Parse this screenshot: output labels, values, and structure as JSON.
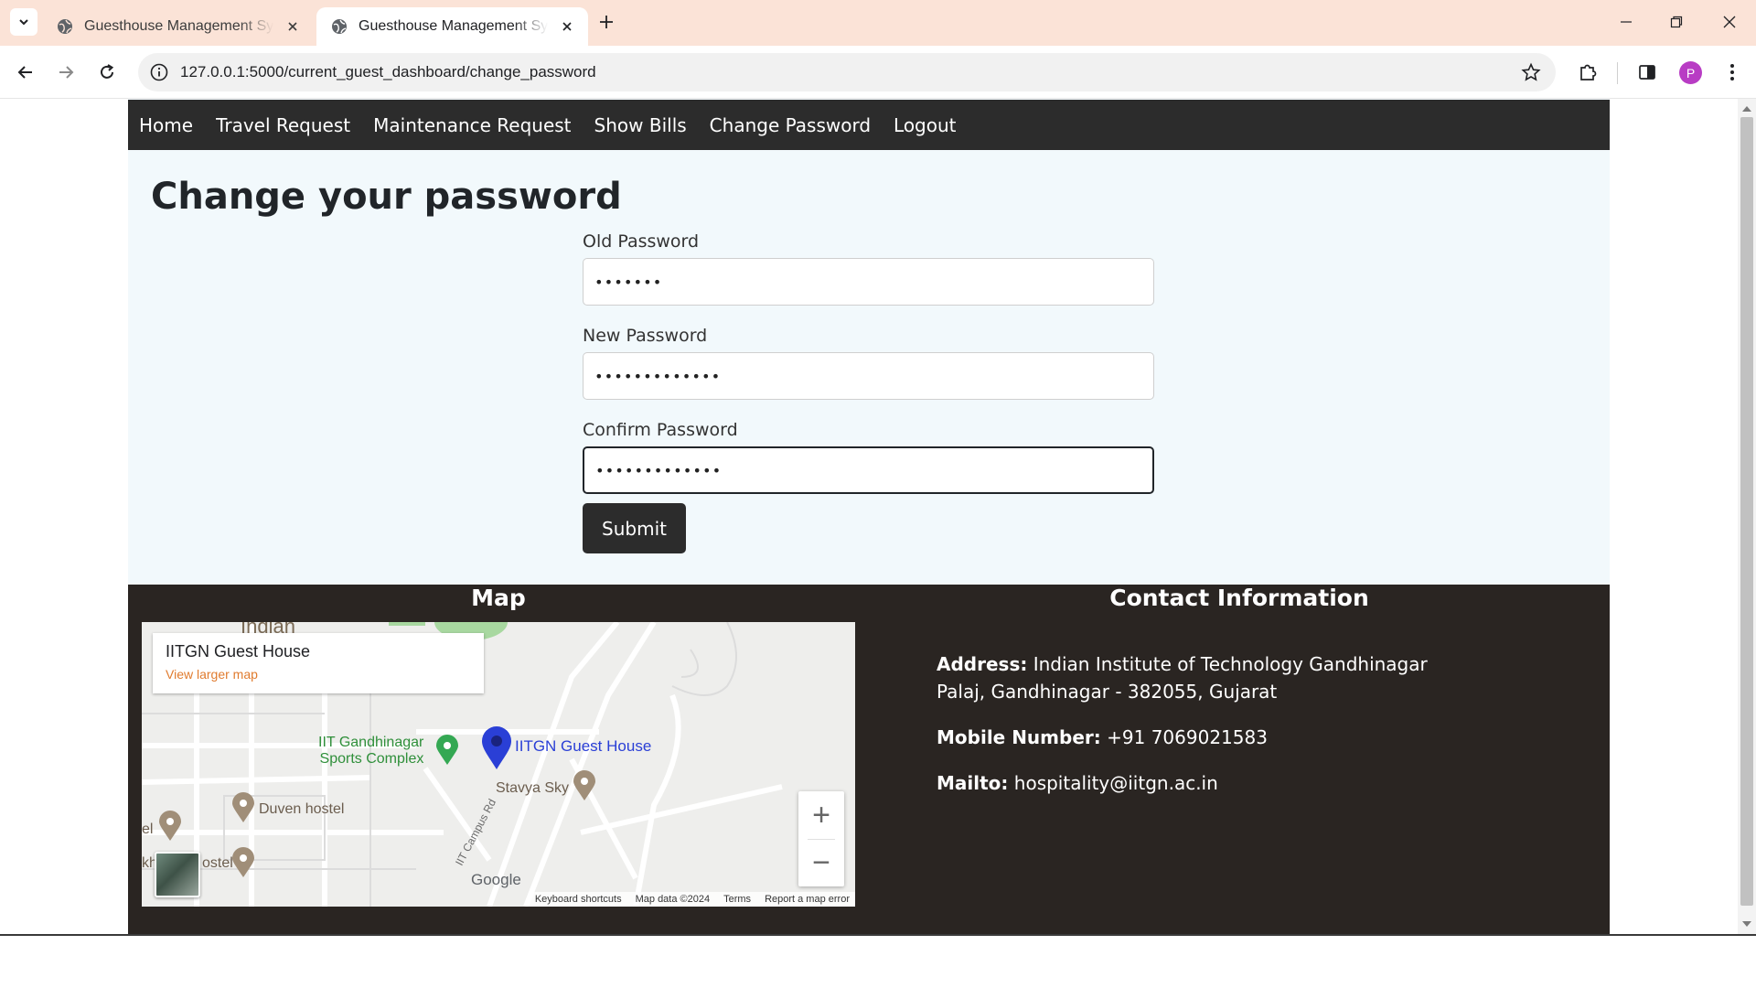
{
  "browser": {
    "tabs": [
      {
        "title": "Guesthouse Management System",
        "active": false
      },
      {
        "title": "Guesthouse Management System",
        "active": true
      }
    ],
    "url": "127.0.0.1:5000/current_guest_dashboard/change_password",
    "profile_initial": "P"
  },
  "nav": {
    "items": [
      "Home",
      "Travel Request",
      "Maintenance Request",
      "Show Bills",
      "Change Password",
      "Logout"
    ]
  },
  "page": {
    "title": "Change your password"
  },
  "form": {
    "old_label": "Old Password",
    "old_value": "•••••••",
    "new_label": "New Password",
    "new_value": "•••••••••••••",
    "confirm_label": "Confirm Password",
    "confirm_value": "•••••••••••••",
    "submit_label": "Submit"
  },
  "footer": {
    "map_heading": "Map",
    "contact_heading": "Contact Information",
    "map": {
      "place_name": "IITGN Guest House",
      "larger_map_link": "View larger map",
      "marker_label": "IITGN Guest House",
      "poi_sports": "IIT Gandhinagar Sports Complex",
      "poi_sports_line1": "IIT Gandhinagar",
      "poi_sports_line2": "Sports Complex",
      "poi_stavya": "Stavya Sky",
      "poi_duven": "Duven hostel",
      "poi_hostel": "ostel",
      "poi_el": "el",
      "poi_kh": "kh",
      "area_label": "Indian",
      "road_label": "IIT Campus Rd",
      "zoom_in": "+",
      "zoom_out": "−",
      "attribution": [
        "Keyboard shortcuts",
        "Map data ©2024",
        "Terms",
        "Report a map error"
      ],
      "google": "Google"
    },
    "contact": {
      "address_label": "Address:",
      "address_line1": "Indian Institute of Technology Gandhinagar",
      "address_line2": "Palaj, Gandhinagar - 382055, Gujarat",
      "mobile_label": "Mobile Number:",
      "mobile": "+91 7069021583",
      "mail_label": "Mailto:",
      "mail": "hospitality@iitgn.ac.in"
    }
  }
}
